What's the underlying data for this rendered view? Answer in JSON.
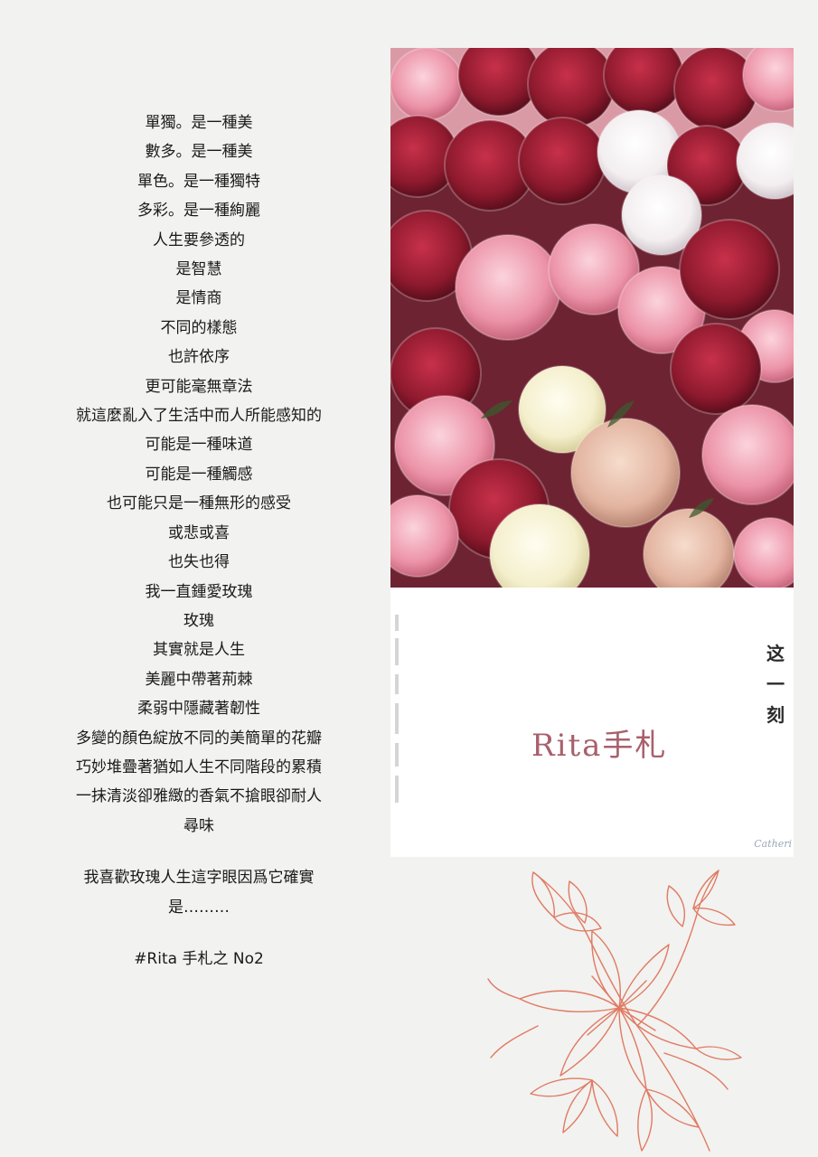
{
  "poem": {
    "lines": [
      "單獨。是一種美",
      "數多。是一種美",
      "單色。是一種獨特",
      "多彩。是一種絢麗",
      "人生要參透的",
      "是智慧",
      "是情商",
      "不同的樣態",
      "也許依序",
      "更可能毫無章法",
      "就這麼亂入了生活中而人所能感知的",
      "可能是一種味道",
      "可能是一種觸感",
      "也可能只是一種無形的感受",
      "或悲或喜",
      "也失也得",
      "我一直鍾愛玫瑰",
      "玫瑰",
      "其實就是人生",
      "美麗中帶著荊棘",
      "柔弱中隱藏著韌性",
      "多變的顏色綻放不同的美簡單的花瓣",
      "巧妙堆疊著猶如人生不同階段的累積",
      "一抹清淡卻雅緻的香氣不搶眼卻耐人",
      "尋味"
    ],
    "closing_1": "我喜歡玫瑰人生這字眼因爲它確實",
    "closing_2": "是………",
    "hashtag": "#Rita 手札之 No2"
  },
  "card": {
    "brand": "Rita手札",
    "vertical_1": "这",
    "vertical_2": "一",
    "vertical_3": "刻",
    "signature": "Catheri"
  },
  "colors": {
    "background": "#f2f2f0",
    "brand_text": "#a8606c",
    "flower_stroke": "#e07a62"
  },
  "icons": {
    "photo": "rose-bouquet-photo",
    "decoration": "lily-line-art-icon"
  }
}
